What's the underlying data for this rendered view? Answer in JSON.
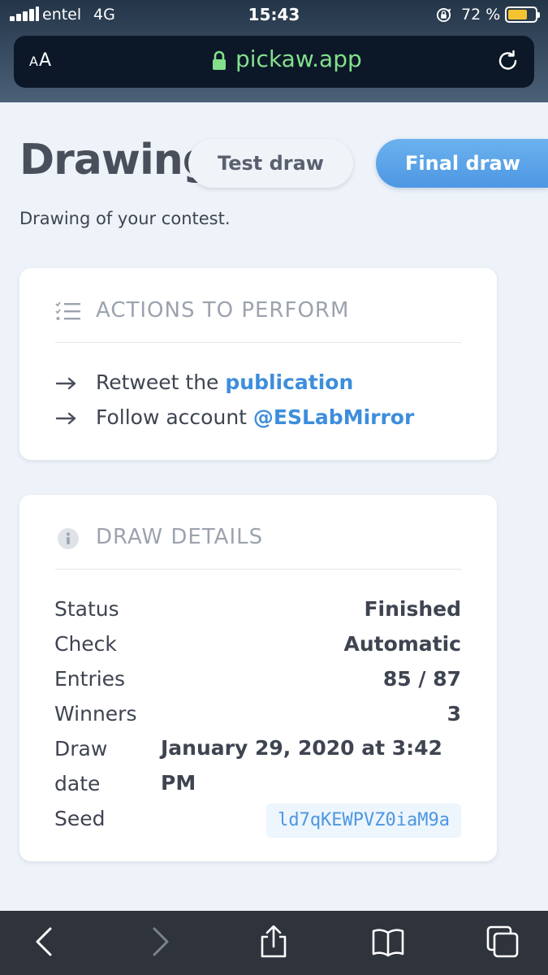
{
  "status_bar": {
    "carrier": "entel",
    "network": "4G",
    "time": "15:43",
    "battery_percent": "72 %",
    "battery_level": 0.72
  },
  "browser": {
    "text_size_label": "AA",
    "url": "pickaw.app"
  },
  "page": {
    "title": "Drawing",
    "subtitle": "Drawing of your contest.",
    "test_draw_label": "Test draw",
    "final_draw_label": "Final draw"
  },
  "actions_card": {
    "heading": "ACTIONS TO PERFORM",
    "items": [
      {
        "text": "Retweet the ",
        "link": "publication"
      },
      {
        "text": "Follow account ",
        "link": "@ESLabMirror"
      }
    ]
  },
  "details_card": {
    "heading": "DRAW DETAILS",
    "status_label": "Status",
    "status_value": "Finished",
    "check_label": "Check",
    "check_value": "Automatic",
    "entries_label": "Entries",
    "entries_value": "85 / 87",
    "winners_label": "Winners",
    "winners_value": "3",
    "draw_date_label_1": "Draw",
    "draw_date_label_2": "date",
    "draw_date_value": "January 29, 2020 at 3:42 PM",
    "seed_label": "Seed",
    "seed_value": "ld7qKEWPVZ0iaM9a"
  },
  "icons": {
    "accent": "#4d97e3",
    "link": "#3d8edc",
    "url_green": "#83e08c",
    "battery": "#f4c430"
  }
}
